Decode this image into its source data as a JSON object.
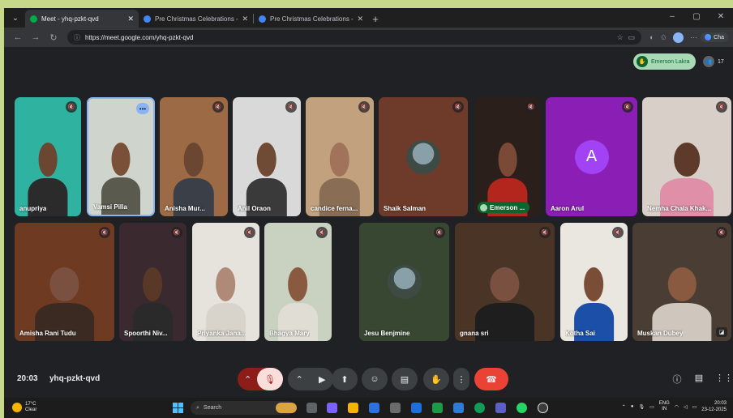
{
  "browser": {
    "tabs": [
      {
        "title": "Meet - yhq-pzkt-qvd",
        "active": true
      },
      {
        "title": "Pre Christmas Celebrations - Goo",
        "active": false
      },
      {
        "title": "Pre Christmas Celebrations - Goo",
        "active": false
      }
    ],
    "url": "https://meet.google.com/yhq-pzkt-qvd",
    "copilot_label": "Cha"
  },
  "meet": {
    "presenter_name": "Emerson Lakra",
    "people_count": "17",
    "participants": [
      {
        "name": "anupriya",
        "bg": "#2fb3a0",
        "skin": "#6b4630",
        "shirt": "#2b2b2b"
      },
      {
        "name": "Vamsi Pilla",
        "bg": "#cfd5cc",
        "skin": "#7a5138",
        "shirt": "#5a5a4e",
        "speaking": true
      },
      {
        "name": "Anisha Mur...",
        "bg": "#9c6a44",
        "skin": "#6b4630",
        "shirt": "#3a3f48"
      },
      {
        "name": "Anil Oraon",
        "bg": "#d9d9d9",
        "skin": "#6f4a34",
        "shirt": "#3a3a3a"
      },
      {
        "name": "candice ferna...",
        "bg": "#c2a27e",
        "skin": "#a0735a",
        "shirt": "#8a6d55"
      },
      {
        "name": "Shaik Salman",
        "bg": "#6e3b2a",
        "avatar": true
      },
      {
        "name": "Emerson ...",
        "bg": "#2a1f1a",
        "skin": "#7a4a36",
        "shirt": "#b3261e",
        "hand": true
      },
      {
        "name": "Aaron Arul",
        "bg": "#8b1fb5",
        "letter": "A"
      },
      {
        "name": "Nemha Chala Khak...",
        "bg": "#d8cfc8",
        "skin": "#5e3a2a",
        "shirt": "#e08fa8"
      },
      {
        "name": "Amisha Rani Tudu",
        "bg": "#6e3a22",
        "skin": "#7a5140",
        "shirt": "#3a2a22"
      },
      {
        "name": "Spoorthi Niv...",
        "bg": "#3a2a30",
        "skin": "#5a3828",
        "shirt": "#2a2a2a"
      },
      {
        "name": "Priyanka Jana...",
        "bg": "#e6e2dc",
        "skin": "#b08a78",
        "shirt": "#d8d4cc"
      },
      {
        "name": "Bhagya Mary",
        "bg": "#c9d1c0",
        "skin": "#8a5a40",
        "shirt": "#e0ddd4"
      },
      {
        "name": "Jesu Benjmine",
        "bg": "#384732",
        "avatar": true
      },
      {
        "name": "gnana sri",
        "bg": "#4a3426",
        "skin": "#7a5040",
        "shirt": "#1e1e1e"
      },
      {
        "name": "Kotha Sai",
        "bg": "#eae6e0",
        "skin": "#7a4e36",
        "shirt": "#1b4fa8"
      },
      {
        "name": "Muskan Dubey",
        "bg": "#4a3e34",
        "skin": "#8a5a40",
        "shirt": "#cfc7bd",
        "pin": true
      }
    ]
  },
  "controls": {
    "time": "20:03",
    "meeting_code": "yhq-pzkt-qvd"
  },
  "taskbar": {
    "temperature": "17°C",
    "weather": "Clear",
    "search_placeholder": "Search",
    "lang_top": "ENG",
    "lang_bottom": "IN",
    "clock_time": "20:03",
    "clock_date": "23-12-2025"
  }
}
